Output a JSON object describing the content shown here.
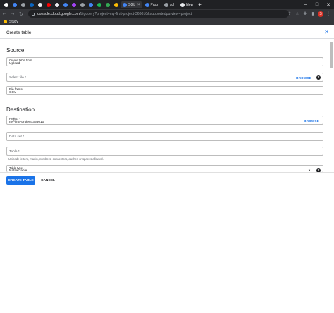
{
  "browser": {
    "tabs": [
      {
        "icon": "gmail-icon",
        "color": "#ffffff",
        "label": ""
      },
      {
        "icon": "chrome-icon",
        "color": "#4285f4",
        "label": ""
      },
      {
        "icon": "tab-icon",
        "color": "#9aa0a6",
        "label": ""
      },
      {
        "icon": "linkedin-icon",
        "color": "#0a66c2",
        "label": ""
      },
      {
        "icon": "notion-icon",
        "color": "#e8eaed",
        "label": ""
      },
      {
        "icon": "youtube-icon",
        "color": "#ff0000",
        "label": ""
      },
      {
        "icon": "github-icon",
        "color": "#e8eaed",
        "label": ""
      },
      {
        "icon": "cloud-icon",
        "color": "#4285f4",
        "label": ""
      },
      {
        "icon": "tab-icon",
        "color": "#a142f4",
        "label": ""
      },
      {
        "icon": "search-tab-icon",
        "color": "#9aa0a6",
        "label": ""
      },
      {
        "icon": "chrome-icon",
        "color": "#4285f4",
        "label": ""
      },
      {
        "icon": "spotify-icon",
        "color": "#1db954",
        "label": ""
      },
      {
        "icon": "tab-icon",
        "color": "#34a853",
        "label": ""
      },
      {
        "icon": "tab-icon",
        "color": "#fbbc04",
        "label": ""
      },
      {
        "icon": "sql-tab-icon",
        "color": "#4285f4",
        "label": "SQL"
      },
      {
        "icon": "chrome-icon",
        "color": "#4285f4",
        "label": "Prop"
      },
      {
        "icon": "tab-icon",
        "color": "#9aa0a6",
        "label": "sql"
      },
      {
        "icon": "github-icon",
        "color": "#e8eaed",
        "label": "New"
      }
    ],
    "active_tab_close": "×",
    "new_tab": "+",
    "window_controls": [
      "–",
      "□",
      "✕"
    ],
    "url_host": "console.cloud.google.com",
    "url_path": "/bigquery?project=my-first-project-366010&supportedpurview=project",
    "profile_initial": "S",
    "bookmark_label": "Study"
  },
  "panel": {
    "title": "Create table",
    "close_glyph": "✕",
    "source": {
      "heading": "Source",
      "create_from_label": "Create table from",
      "create_from_value": "Upload",
      "select_file_placeholder": "Select file *",
      "browse_label": "BROWSE",
      "file_format_label": "File format",
      "file_format_value": "CSV"
    },
    "destination": {
      "heading": "Destination",
      "project_label": "Project *",
      "project_value": "my-first-project-366010",
      "browse_label": "BROWSE",
      "dataset_placeholder": "Data set *",
      "table_placeholder": "Table *",
      "table_hint": "Unicode letters, marks, numbers, connectors, dashes or spaces allowed.",
      "table_type_label": "Table type",
      "table_type_value": "Native table"
    },
    "help_glyph": "?",
    "dropdown_glyph": "▼",
    "create_button": "CREATE TABLE",
    "cancel_button": "CANCEL"
  }
}
